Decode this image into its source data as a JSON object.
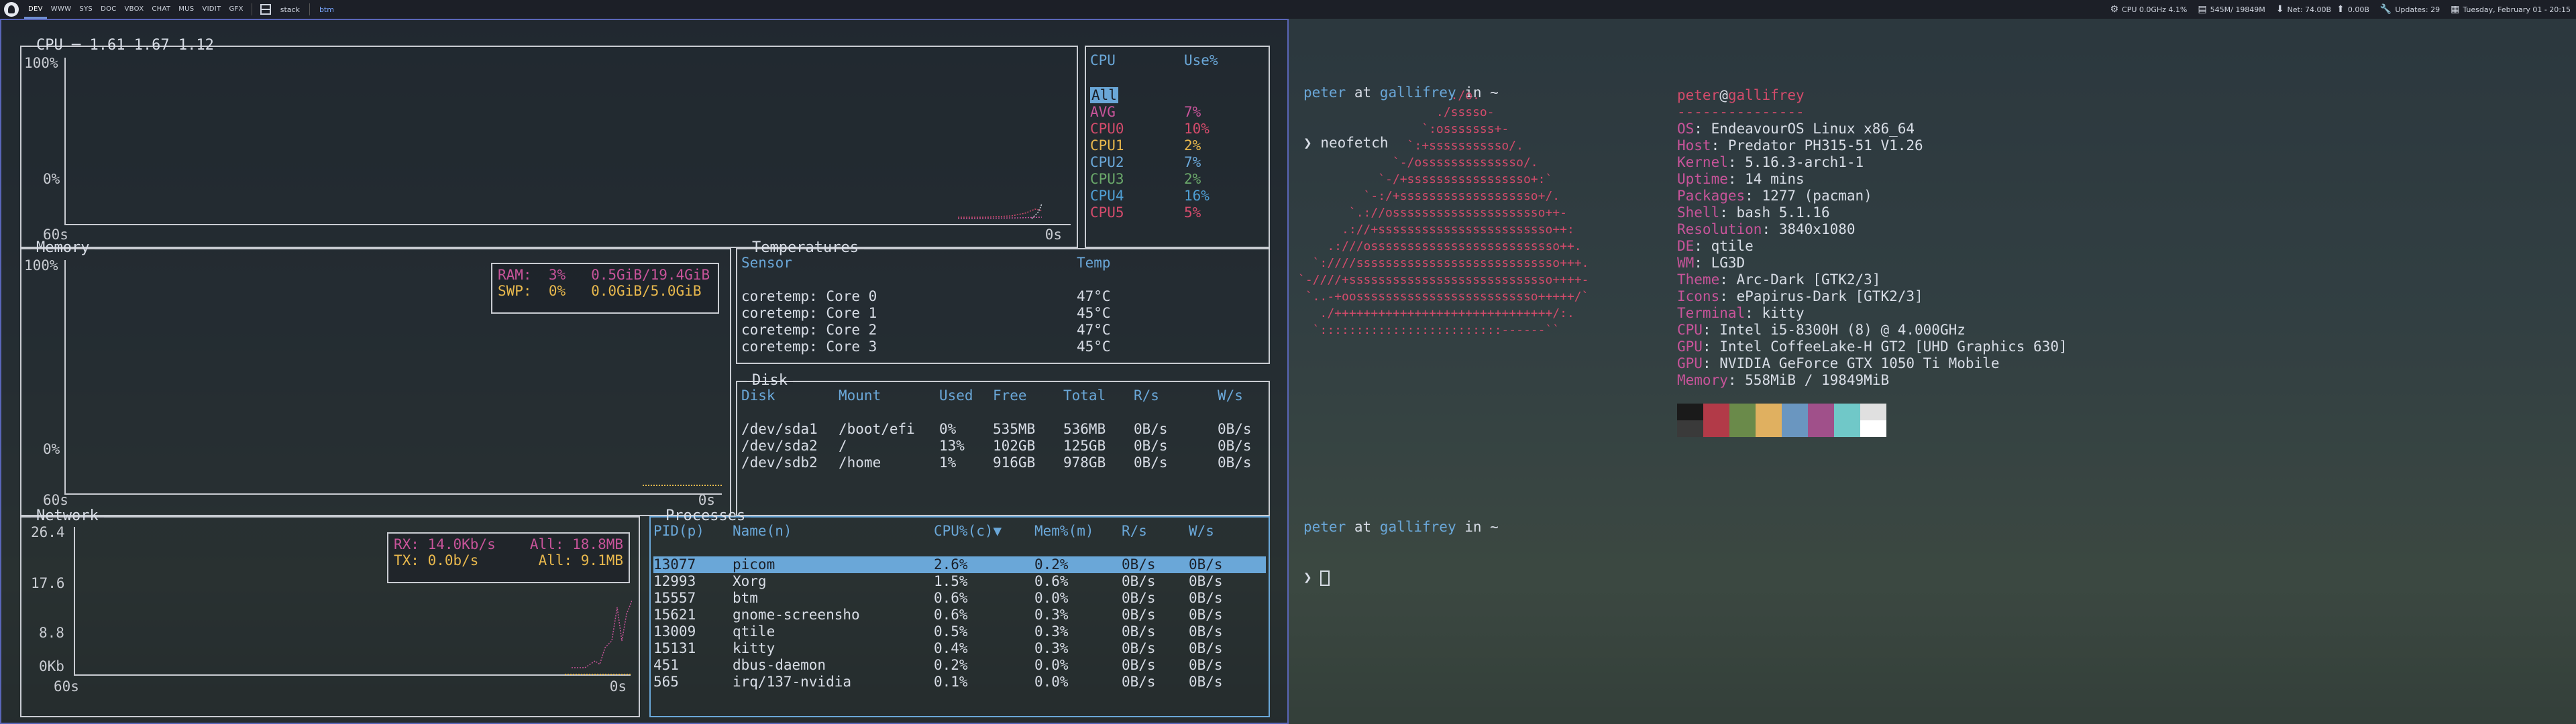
{
  "topbar": {
    "workspaces": [
      "DEV",
      "WWW",
      "SYS",
      "DOC",
      "VBOX",
      "CHAT",
      "MUS",
      "VIDIT",
      "GFX"
    ],
    "active_workspace": 0,
    "layout": "stack",
    "windows": [
      "btm"
    ],
    "active_window": 0,
    "cpu": "CPU 0.0GHz 4.1%",
    "memory": "545M/ 19849M",
    "net": "Net: 74.00B",
    "net_up": "0.00B",
    "updates": "Updates: 29",
    "date": "Tuesday, February 01 - 20:15"
  },
  "btm": {
    "cpu": {
      "title": "CPU ─ 1.61 1.67 1.12",
      "y_max": "100%",
      "y_min": "0%",
      "x_left": "60s",
      "x_right": "0s",
      "list_header": [
        "CPU",
        "Use%"
      ],
      "rows": [
        {
          "name": "All",
          "use": "",
          "color": "#6aa7d8"
        },
        {
          "name": "AVG",
          "use": "7%",
          "color": "#c8549a"
        },
        {
          "name": "CPU0",
          "use": "10%",
          "color": "#d34b6b"
        },
        {
          "name": "CPU1",
          "use": "2%",
          "color": "#e8b84d"
        },
        {
          "name": "CPU2",
          "use": "7%",
          "color": "#6aa7d8"
        },
        {
          "name": "CPU3",
          "use": "2%",
          "color": "#6aa86a"
        },
        {
          "name": "CPU4",
          "use": "16%",
          "color": "#4f9fd4"
        },
        {
          "name": "CPU5",
          "use": "5%",
          "color": "#d34b6b"
        }
      ]
    },
    "memory": {
      "title": "Memory",
      "y_max": "100%",
      "y_min": "0%",
      "x_left": "60s",
      "x_right": "0s",
      "ram": {
        "label": "RAM:",
        "pct": "3%",
        "val": "0.5GiB/19.4GiB"
      },
      "swp": {
        "label": "SWP:",
        "pct": "0%",
        "val": "0.0GiB/5.0GiB"
      }
    },
    "temperatures": {
      "title": "Temperatures",
      "header": [
        "Sensor",
        "Temp"
      ],
      "rows": [
        [
          "coretemp: Core 0",
          "47°C"
        ],
        [
          "coretemp: Core 1",
          "45°C"
        ],
        [
          "coretemp: Core 2",
          "47°C"
        ],
        [
          "coretemp: Core 3",
          "45°C"
        ]
      ]
    },
    "disk": {
      "title": "Disk",
      "header": [
        "Disk",
        "Mount",
        "Used",
        "Free",
        "Total",
        "R/s",
        "W/s"
      ],
      "rows": [
        [
          "/dev/sda1",
          "/boot/efi",
          "0%",
          "535MB",
          "536MB",
          "0B/s",
          "0B/s"
        ],
        [
          "/dev/sda2",
          "/",
          "13%",
          "102GB",
          "125GB",
          "0B/s",
          "0B/s"
        ],
        [
          "/dev/sdb2",
          "/home",
          "1%",
          "916GB",
          "978GB",
          "0B/s",
          "0B/s"
        ]
      ]
    },
    "network": {
      "title": "Network",
      "y_ticks": [
        "26.4",
        "17.6",
        "8.8",
        "0Kb"
      ],
      "x_left": "60s",
      "x_right": "0s",
      "rx": "RX: 14.0Kb/s",
      "rx_all": "All: 18.8MB",
      "tx": "TX: 0.0b/s",
      "tx_all": "All: 9.1MB"
    },
    "processes": {
      "title": "Processes",
      "header": [
        "PID(p)",
        "Name(n)",
        "CPU%(c)▼",
        "Mem%(m)",
        "R/s",
        "W/s"
      ],
      "rows": [
        [
          "13077",
          "picom",
          "2.6%",
          "0.2%",
          "0B/s",
          "0B/s"
        ],
        [
          "12993",
          "Xorg",
          "1.5%",
          "0.6%",
          "0B/s",
          "0B/s"
        ],
        [
          "15557",
          "btm",
          "0.6%",
          "0.0%",
          "0B/s",
          "0B/s"
        ],
        [
          "15621",
          "gnome-screensho",
          "0.6%",
          "0.3%",
          "0B/s",
          "0B/s"
        ],
        [
          "13009",
          "qtile",
          "0.5%",
          "0.3%",
          "0B/s",
          "0B/s"
        ],
        [
          "15131",
          "kitty",
          "0.4%",
          "0.3%",
          "0B/s",
          "0B/s"
        ],
        [
          "451",
          "dbus-daemon",
          "0.2%",
          "0.0%",
          "0B/s",
          "0B/s"
        ],
        [
          "565",
          "irq/137-nvidia",
          "0.1%",
          "0.0%",
          "0B/s",
          "0B/s"
        ]
      ]
    }
  },
  "terminal": {
    "prompt1": {
      "user": "peter",
      "at": " at ",
      "host": "gallifrey",
      "in": " in ",
      "dir": "~"
    },
    "command": "neofetch",
    "prompt2": {
      "user": "peter",
      "at": " at ",
      "host": "gallifrey",
      "in": " in ",
      "dir": "~"
    },
    "symbol": "❯",
    "ascii_art": "                     ./o.\n                   ./sssso-\n                 `:osssssss+-\n               `:+sssssssssso/.\n             `-/ossssssssssssso/.\n           `-/+sssssssssssssssso+:`\n         `-:/+sssssssssssssssssso+/.\n       `.://osssssssssssssssssssso++-\n      .://+ssssssssssssssssssssssso++:\n    .:///ossssssssssssssssssssssssso++.\n  `:////ssssssssssssssssssssssssssso+++.\n`-////+ssssssssssssssssssssssssssso++++-\n `..-+oosssssssssssssssssssssssso+++++/`\n   ./++++++++++++++++++++++++++++++/:.\n  `:::::::::::::::::::::::::------``",
    "user_host": {
      "user": "peter",
      "at": "@",
      "host": "gallifrey"
    },
    "rule": "---------------",
    "info": [
      {
        "k": "OS",
        "v": "EndeavourOS Linux x86_64"
      },
      {
        "k": "Host",
        "v": "Predator PH315-51 V1.26"
      },
      {
        "k": "Kernel",
        "v": "5.16.3-arch1-1"
      },
      {
        "k": "Uptime",
        "v": "14 mins"
      },
      {
        "k": "Packages",
        "v": "1277 (pacman)"
      },
      {
        "k": "Shell",
        "v": "bash 5.1.16"
      },
      {
        "k": "Resolution",
        "v": "3840x1080"
      },
      {
        "k": "DE",
        "v": "qtile"
      },
      {
        "k": "WM",
        "v": "LG3D"
      },
      {
        "k": "Theme",
        "v": "Arc-Dark [GTK2/3]"
      },
      {
        "k": "Icons",
        "v": "ePapirus-Dark [GTK2/3]"
      },
      {
        "k": "Terminal",
        "v": "kitty"
      },
      {
        "k": "CPU",
        "v": "Intel i5-8300H (8) @ 4.000GHz"
      },
      {
        "k": "GPU",
        "v": "Intel CoffeeLake-H GT2 [UHD Graphics 630]"
      },
      {
        "k": "GPU",
        "v": "NVIDIA GeForce GTX 1050 Ti Mobile"
      },
      {
        "k": "Memory",
        "v": "558MiB / 19849MiB"
      }
    ],
    "palette": [
      "#1a1a1a",
      "#b23a48",
      "#6a8a4a",
      "#e0b060",
      "#6a96c0",
      "#a0508a",
      "#70c8c8",
      "#e0e0e0",
      "#3a3a3a",
      "#b23a48",
      "#6a8a4a",
      "#e0b060",
      "#6a96c0",
      "#a0508a",
      "#70c8c8",
      "#ffffff"
    ]
  }
}
